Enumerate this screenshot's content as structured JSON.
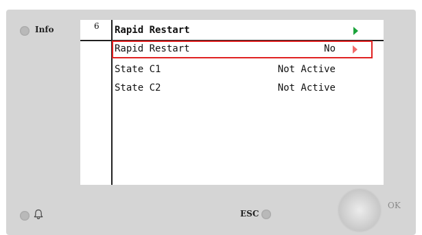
{
  "panel": {
    "info_label": "Info",
    "esc_label": "ESC",
    "ok_label": "OK"
  },
  "screen": {
    "page_number": "6",
    "title": "Rapid Restart",
    "rows": [
      {
        "label": "Rapid Restart",
        "value": "No",
        "selected": true
      },
      {
        "label": "State C1",
        "value": "Not Active",
        "selected": false
      },
      {
        "label": "State C2",
        "value": "Not Active",
        "selected": false
      }
    ]
  },
  "icons": {
    "alarm": "bell-icon",
    "title_arrow": "arrow-right-icon",
    "row_arrow": "arrow-right-icon"
  },
  "colors": {
    "panel_bg": "#d5d5d5",
    "title_arrow": "#1aa33a",
    "selection": "#e02020",
    "row_arrow": "#f26b6b"
  }
}
